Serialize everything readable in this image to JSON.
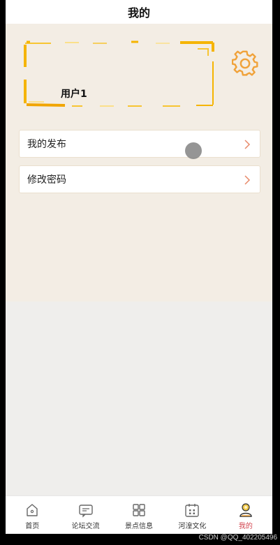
{
  "header": {
    "title": "我的"
  },
  "profile": {
    "username": "用户1",
    "settings_icon": "gear-icon"
  },
  "menu": [
    {
      "label": "我的发布",
      "icon": "chevron-right-icon"
    },
    {
      "label": "修改密码",
      "icon": "chevron-right-icon"
    }
  ],
  "tabbar": {
    "active_index": 4,
    "items": [
      {
        "label": "首页",
        "icon": "home-icon"
      },
      {
        "label": "论坛交流",
        "icon": "chat-icon"
      },
      {
        "label": "景点信息",
        "icon": "grid-icon"
      },
      {
        "label": "河湟文化",
        "icon": "calendar-icon"
      },
      {
        "label": "我的",
        "icon": "profile-icon"
      }
    ]
  },
  "watermark": "CSDN @QQ_402205496",
  "colors": {
    "accent": "#f0a23a",
    "active_tab": "#d3454f",
    "frame_gold": "#f5b400",
    "background": "#f3ede4"
  }
}
